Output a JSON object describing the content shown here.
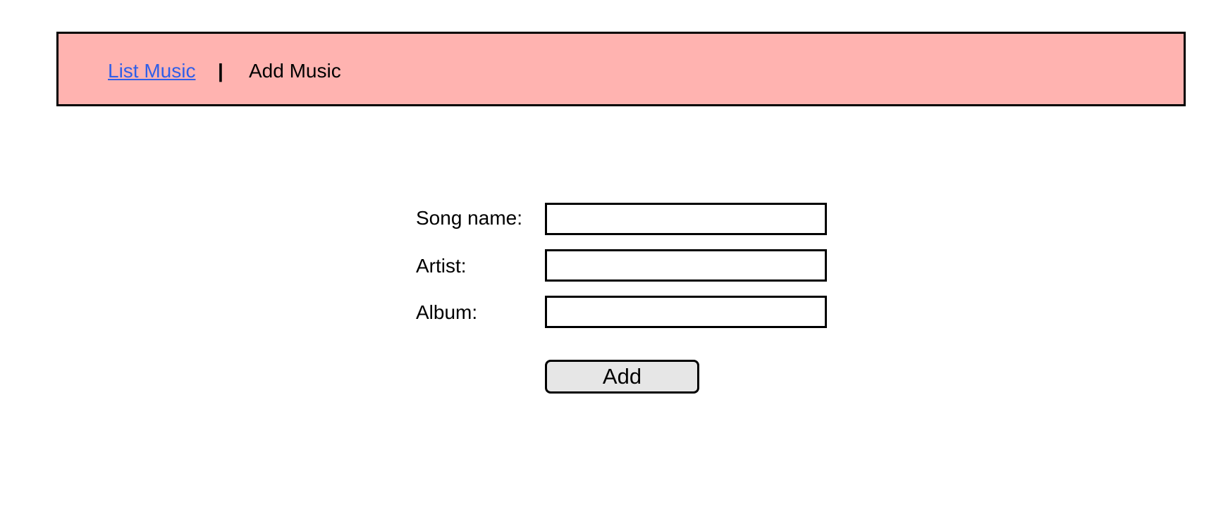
{
  "nav": {
    "list_music_link": "List Music",
    "separator": "|",
    "current_page": "Add Music"
  },
  "form": {
    "song_name": {
      "label": "Song name:",
      "value": ""
    },
    "artist": {
      "label": "Artist:",
      "value": ""
    },
    "album": {
      "label": "Album:",
      "value": ""
    },
    "submit_label": "Add"
  },
  "colors": {
    "nav_background": "#ffb3b0",
    "link": "#2f5ee8",
    "button_background": "#e6e6e6"
  }
}
